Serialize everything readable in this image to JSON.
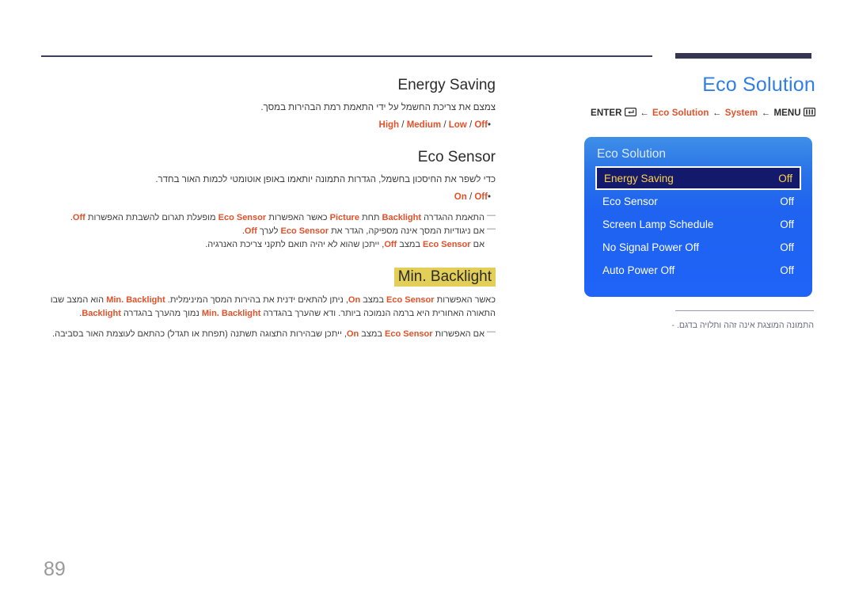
{
  "page": {
    "number": "89"
  },
  "header": {
    "title": "Eco Solution"
  },
  "breadcrumb": {
    "enter_label": "ENTER",
    "enter_icon": "enter-key-icon",
    "arrow": "←",
    "item1": "Eco Solution",
    "item2": "System",
    "menu_label": "MENU",
    "menu_icon": "menu-grid-icon"
  },
  "osd": {
    "title": "Eco Solution",
    "rows": [
      {
        "label": "Energy Saving",
        "value": "Off",
        "selected": true
      },
      {
        "label": "Eco Sensor",
        "value": "Off",
        "selected": false
      },
      {
        "label": "Screen Lamp Schedule",
        "value": "Off",
        "selected": false
      },
      {
        "label": "No Signal Power Off",
        "value": "Off",
        "selected": false
      },
      {
        "label": "Auto Power Off",
        "value": "Off",
        "selected": false
      }
    ]
  },
  "footnote": {
    "dash": "-",
    "text": "התמונה המוצגת אינה זהה ותלויה בדגם."
  },
  "sections": {
    "energy_saving": {
      "heading": "Energy Saving",
      "description": "צמצם את צריכת החשמל על ידי התאמת רמת הבהירות במסך.",
      "bullet": "•",
      "options": "High / Medium / Low / Off"
    },
    "eco_sensor": {
      "heading": "Eco Sensor",
      "description": "כדי לשפר את החיסכון בחשמל, הגדרות התמונה יותאמו באופן אוטומטי לכמות האור בחדר.",
      "bullet": "•",
      "options": "On / Off",
      "note1": "התאמת ההגדרה Backlight תחת Picture כאשר האפשרות Eco Sensor מופעלת תגרום להשבתת האפשרות Off.",
      "note2": "אם ניגודיות המסך אינה מספיקה, הגדר את Eco Sensor לערך Off.",
      "note3": "אם Eco Sensor במצב Off, ייתכן שהוא לא יהיה תואם לתקני צריכת האנרגיה."
    },
    "min_backlight": {
      "heading": "Min. Backlight",
      "paragraph": "כאשר האפשרות Eco Sensor במצב On, ניתן להתאים ידנית את בהירות המסך המינימלית. Min. Backlight הוא המצב שבו התאורה האחורית היא ברמה הנמוכה ביותר. ודא שהערך בהגדרה Min. Backlight נמוך מהערך בהגדרה Backlight.",
      "note1": "אם האפשרות Eco Sensor במצב On, ייתכן שבהירות התצוגה תשתנה (תפחת או תגדל) כהתאם לעוצמת האור בסביבה."
    }
  },
  "colors": {
    "accent_orange": "#e1512a",
    "title_blue": "#2f7ee8",
    "osd_blue": "#1f63f0",
    "osd_selected": "#131a6b",
    "osd_selected_text": "#ffd24a",
    "highlight_yellow": "#e3cf57",
    "rule_navy": "#353552"
  }
}
